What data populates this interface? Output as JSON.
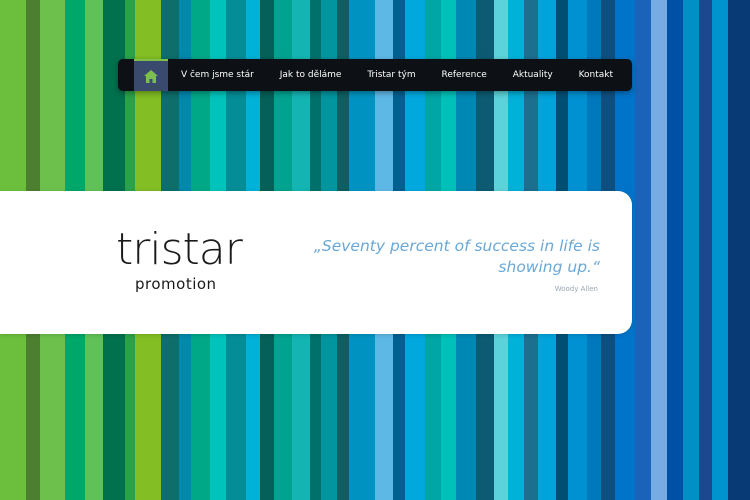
{
  "background_stripe_colors": [
    "#6cbf3c",
    "#4d7f31",
    "#6dc04b",
    "#00a76a",
    "#60c158",
    "#00704d",
    "#2aa14a",
    "#83be24",
    "#0d6e6a",
    "#0088ad",
    "#00a888",
    "#00c3bb",
    "#058d97",
    "#00b2d7",
    "#046058",
    "#00a38f",
    "#14b4b3",
    "#00716a",
    "#02959f",
    "#0e5e62",
    "#0093c1",
    "#5eb8e6",
    "#00608f",
    "#00a8de",
    "#00a5a5",
    "#00c1b9",
    "#0088b4",
    "#0c5b73",
    "#5bd3d9",
    "#00b1d8",
    "#1c6f8f",
    "#00a3da",
    "#004f73",
    "#0091d3",
    "#0078bc",
    "#0f4f80",
    "#0074c9",
    "#1b63b8",
    "#77abe3",
    "#0050a5",
    "#0090c5",
    "#1b488e",
    "#0094cf",
    "#083b75"
  ],
  "nav": {
    "home_icon": "house-icon",
    "items": [
      "V čem jsme stár",
      "Jak to děláme",
      "Tristar tým",
      "Reference",
      "Aktuality",
      "Kontakt"
    ]
  },
  "logo": {
    "main": "tristar",
    "sub": "promotion"
  },
  "quote": {
    "text": "„Seventy percent of success in life is showing up.“",
    "author": "Woody Allen"
  }
}
